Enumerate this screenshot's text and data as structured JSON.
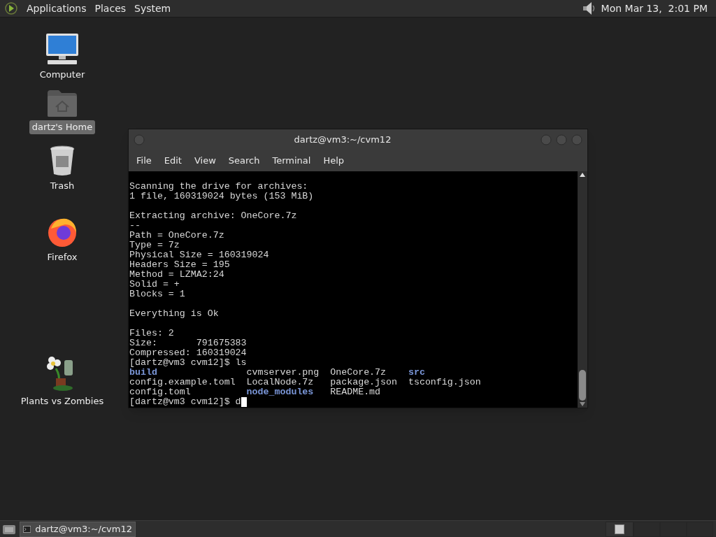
{
  "top_panel": {
    "menus": [
      "Applications",
      "Places",
      "System"
    ],
    "clock": "Mon Mar 13,  2:01 PM"
  },
  "desktop_icons": [
    {
      "kind": "computer",
      "label": "Computer",
      "selected": false
    },
    {
      "kind": "home",
      "label": "dartz's Home",
      "selected": true
    },
    {
      "kind": "trash",
      "label": "Trash",
      "selected": false
    },
    {
      "kind": "firefox",
      "label": "Firefox",
      "selected": false
    },
    {
      "kind": "game",
      "label": "Plants vs Zombies",
      "selected": false
    }
  ],
  "window": {
    "title": "dartz@vm3:~/cvm12",
    "menu": [
      "File",
      "Edit",
      "View",
      "Search",
      "Terminal",
      "Help"
    ],
    "blocks": [
      [
        "Scanning the drive for archives:",
        "1 file, 160319024 bytes (153 MiB)"
      ],
      [
        "Extracting archive: OneCore.7z",
        "--",
        "Path = OneCore.7z",
        "Type = 7z",
        "Physical Size = 160319024",
        "Headers Size = 195",
        "Method = LZMA2:24",
        "Solid = +",
        "Blocks = 1"
      ],
      [
        "Everything is Ok"
      ],
      [
        "Files: 2",
        "Size:       791675383",
        "Compressed: 160319024",
        "[dartz@vm3 cvm12]$ ls"
      ]
    ],
    "ls_rows": [
      [
        {
          "name": "build",
          "kind": "dir"
        },
        {
          "name": "cvmserver.png",
          "kind": "file"
        },
        {
          "name": "OneCore.7z",
          "kind": "file"
        },
        {
          "name": "src",
          "kind": "dir"
        }
      ],
      [
        {
          "name": "config.example.toml",
          "kind": "file"
        },
        {
          "name": "LocalNode.7z",
          "kind": "file"
        },
        {
          "name": "package.json",
          "kind": "file"
        },
        {
          "name": "tsconfig.json",
          "kind": "file"
        }
      ],
      [
        {
          "name": "config.toml",
          "kind": "file"
        },
        {
          "name": "node_modules",
          "kind": "dir"
        },
        {
          "name": "README.md",
          "kind": "file"
        }
      ]
    ],
    "prompt": "[dartz@vm3 cvm12]$ d"
  },
  "taskbar": {
    "tasks": [
      {
        "label": "dartz@vm3:~/cvm12",
        "selected": true
      }
    ]
  }
}
